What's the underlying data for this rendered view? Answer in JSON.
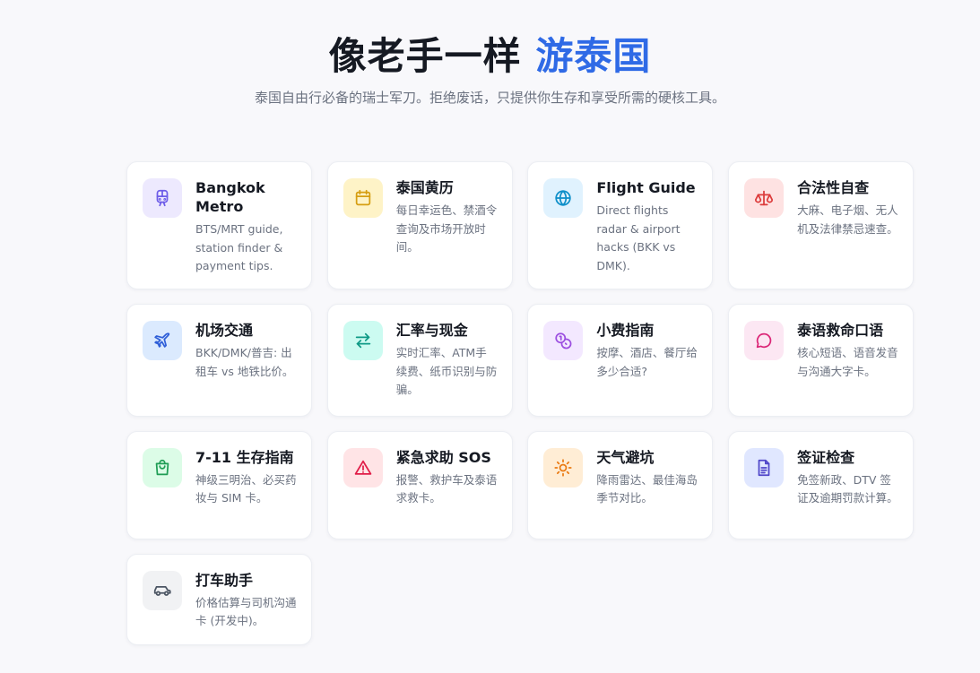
{
  "hero": {
    "title_main": "像老手一样",
    "title_accent": "游泰国",
    "subtitle": "泰国自由行必备的瑞士军刀。拒绝废话，只提供你生存和享受所需的硬核工具。"
  },
  "tools": [
    {
      "title": "Bangkok Metro",
      "desc": "BTS/MRT guide, station finder & payment tips.",
      "icon": "train-icon",
      "color": "#6d5ce8"
    },
    {
      "title": "泰国黄历",
      "desc": "每日幸运色、禁酒令查询及市场开放时间。",
      "icon": "calendar-icon",
      "color": "#d69e12"
    },
    {
      "title": "Flight Guide",
      "desc": "Direct flights radar & airport hacks (BKK vs DMK).",
      "icon": "globe-icon",
      "color": "#0e8fc9"
    },
    {
      "title": "合法性自查",
      "desc": "大麻、电子烟、无人机及法律禁忌速查。",
      "icon": "scale-icon",
      "color": "#dc3b3b"
    },
    {
      "title": "机场交通",
      "desc": "BKK/DMK/普吉: 出租车 vs 地铁比价。",
      "icon": "plane-icon",
      "color": "#2f5fd8"
    },
    {
      "title": "汇率与现金",
      "desc": "实时汇率、ATM手续费、纸币识别与防骗。",
      "icon": "exchange-icon",
      "color": "#0f9a86"
    },
    {
      "title": "小费指南",
      "desc": "按摩、酒店、餐厅给多少合适?",
      "icon": "coins-icon",
      "color": "#9b4ee0"
    },
    {
      "title": "泰语救命口语",
      "desc": "核心短语、语音发音与沟通大字卡。",
      "icon": "chat-icon",
      "color": "#db2777"
    },
    {
      "title": "7-11 生存指南",
      "desc": "神级三明治、必买药妆与 SIM 卡。",
      "icon": "shopping-bag-icon",
      "color": "#1f9d55"
    },
    {
      "title": "紧急求助 SOS",
      "desc": "报警、救护车及泰语求救卡。",
      "icon": "alert-triangle-icon",
      "color": "#e11d48"
    },
    {
      "title": "天气避坑",
      "desc": "降雨雷达、最佳海岛季节对比。",
      "icon": "sun-icon",
      "color": "#ea7a12"
    },
    {
      "title": "签证检查",
      "desc": "免签新政、DTV 签证及逾期罚款计算。",
      "icon": "document-icon",
      "color": "#4f46c9"
    },
    {
      "title": "打车助手",
      "desc": "价格估算与司机沟通卡 (开发中)。",
      "icon": "car-icon",
      "color": "#4b5563"
    }
  ]
}
